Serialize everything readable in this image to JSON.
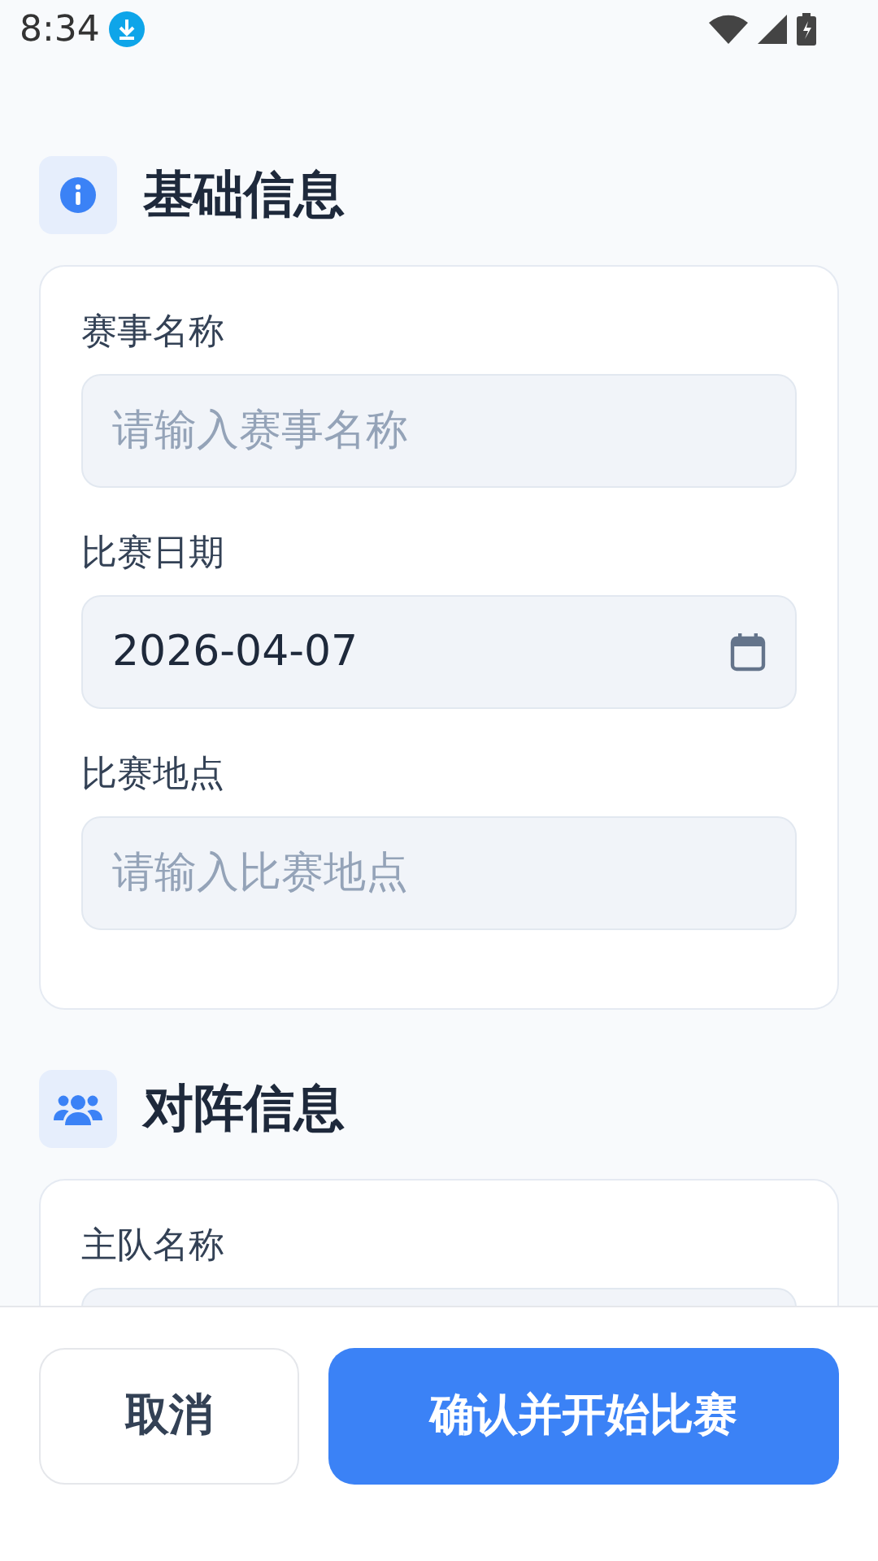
{
  "status_bar": {
    "time": "8:34"
  },
  "sections": [
    {
      "title": "基础信息",
      "fields": [
        {
          "label": "赛事名称",
          "kind": "text",
          "placeholder": "请输入赛事名称"
        },
        {
          "label": "比赛日期",
          "kind": "date",
          "value": "2026-04-07"
        },
        {
          "label": "比赛地点",
          "kind": "text",
          "placeholder": "请输入比赛地点"
        }
      ]
    },
    {
      "title": "对阵信息",
      "fields": [
        {
          "label": "主队名称",
          "kind": "text"
        }
      ]
    }
  ],
  "buttons": [
    {
      "label": "取消",
      "kind": "secondary"
    },
    {
      "label": "确认并开始比赛",
      "kind": "primary"
    }
  ]
}
